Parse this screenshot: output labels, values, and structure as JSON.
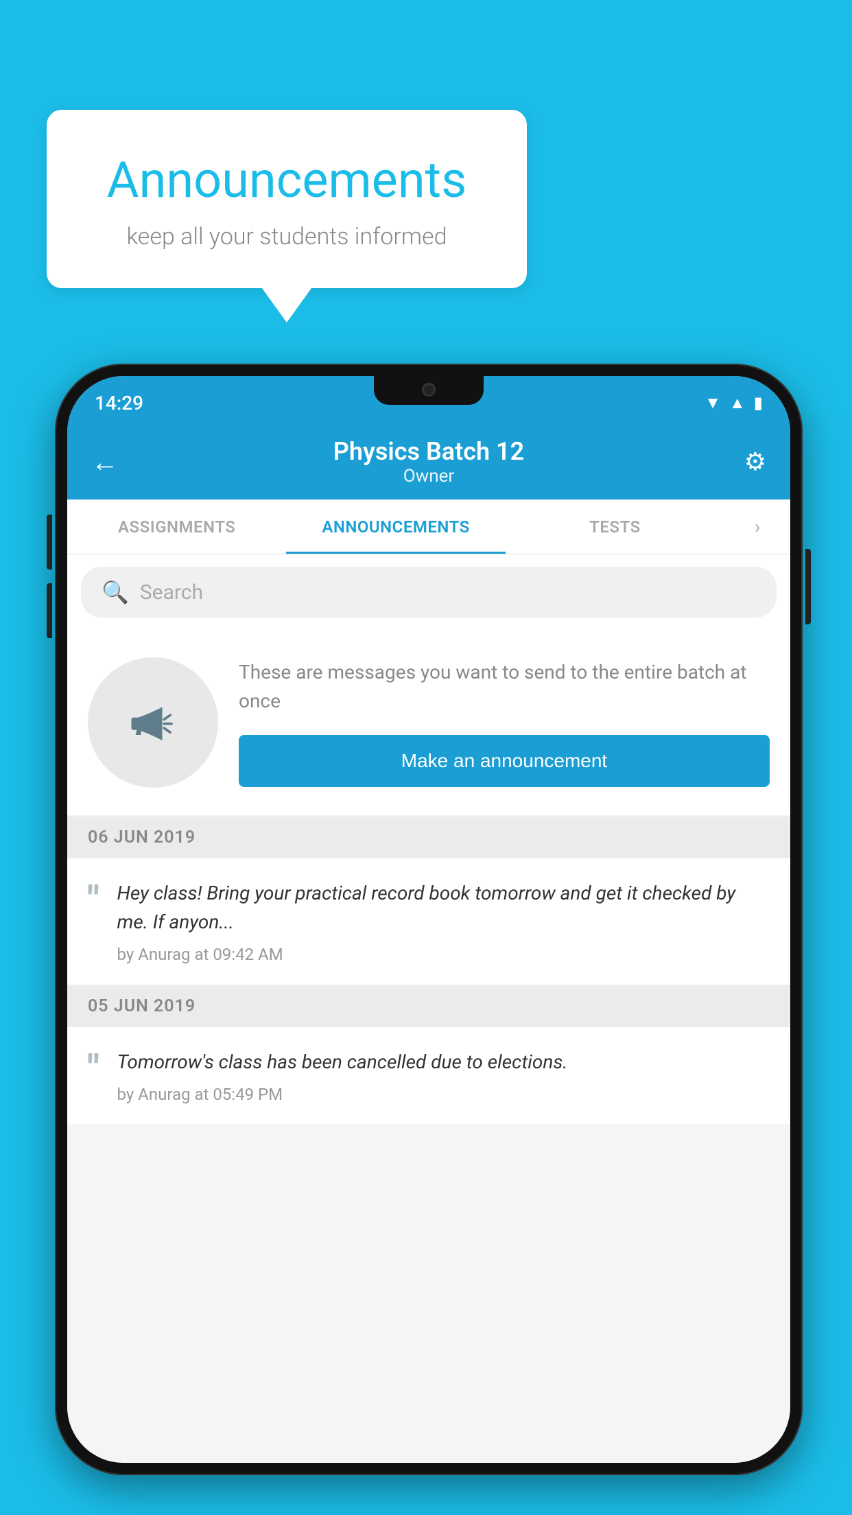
{
  "page": {
    "background_color": "#1BBDE8"
  },
  "speech_bubble": {
    "title": "Announcements",
    "subtitle": "keep all your students informed"
  },
  "phone": {
    "status_bar": {
      "time": "14:29"
    },
    "app_bar": {
      "title": "Physics Batch 12",
      "subtitle": "Owner",
      "back_label": "←",
      "settings_label": "⚙"
    },
    "tabs": [
      {
        "label": "ASSIGNMENTS",
        "active": false
      },
      {
        "label": "ANNOUNCEMENTS",
        "active": true
      },
      {
        "label": "TESTS",
        "active": false
      }
    ],
    "search": {
      "placeholder": "Search"
    },
    "promo": {
      "description": "These are messages you want to send to the entire batch at once",
      "button_label": "Make an announcement"
    },
    "announcements": [
      {
        "date": "06  JUN  2019",
        "text": "Hey class! Bring your practical record book tomorrow and get it checked by me. If anyon...",
        "meta": "by Anurag at 09:42 AM"
      },
      {
        "date": "05  JUN  2019",
        "text": "Tomorrow's class has been cancelled due to elections.",
        "meta": "by Anurag at 05:49 PM"
      }
    ]
  }
}
